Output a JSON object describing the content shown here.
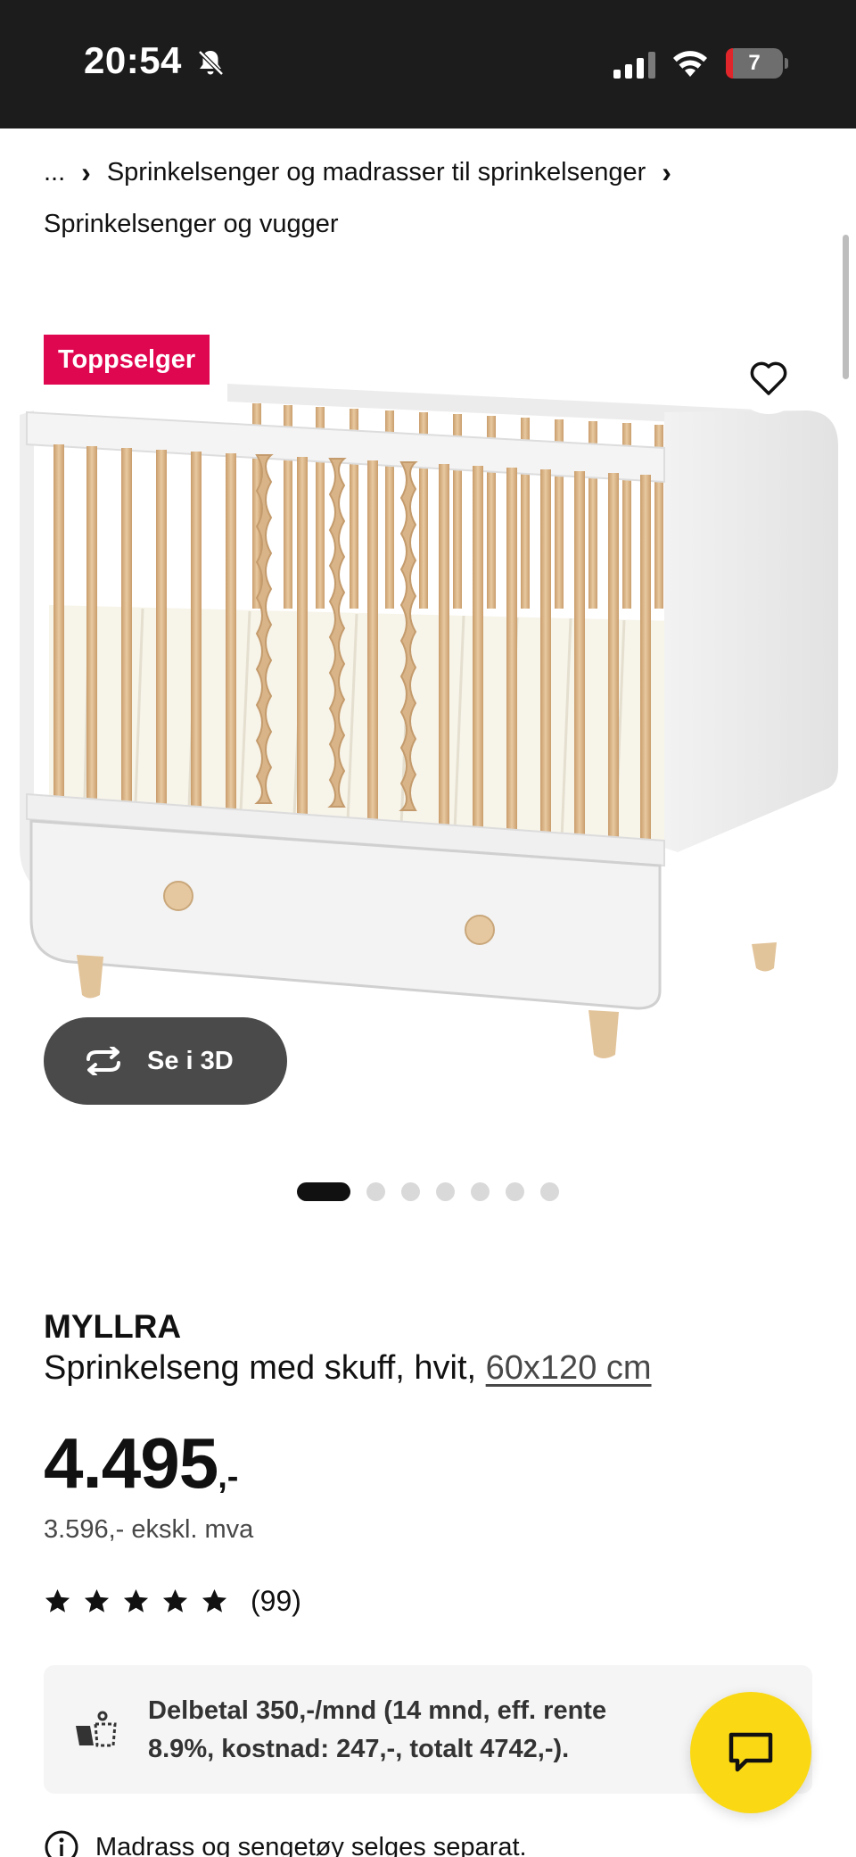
{
  "status_bar": {
    "time": "20:54",
    "battery_level": "7",
    "icons": [
      "bell-muted-icon",
      "cellular-signal-icon",
      "wifi-icon",
      "battery-icon"
    ]
  },
  "breadcrumb": {
    "ellipsis": "...",
    "items": [
      "Sprinkelsenger og madrasser til sprinkelsenger",
      "Sprinkelsenger og vugger"
    ]
  },
  "image": {
    "badge": "Toppselger",
    "view3d_label": "Se i 3D",
    "carousel_count": 7,
    "carousel_active": 1
  },
  "product": {
    "brand": "MYLLRA",
    "description": "Sprinkelseng med skuff, hvit,",
    "size": "60x120 cm",
    "price": "4.495",
    "price_suffix": ",-",
    "price_ex_vat": "3.596,- ekskl. mva",
    "rating_stars": 5,
    "rating_count": "(99)"
  },
  "payment": {
    "text": "Delbetal 350,-/mnd (14 mnd, eff. rente 8.9%, kostnad: 247,-, totalt 4742,-)."
  },
  "notice": {
    "text": "Madrass og sengetøy selges separat."
  },
  "colors": {
    "status_bar": "#1c1c1c",
    "badge": "#e00751",
    "chat": "#fad914",
    "pill": "#4a4a4a"
  }
}
